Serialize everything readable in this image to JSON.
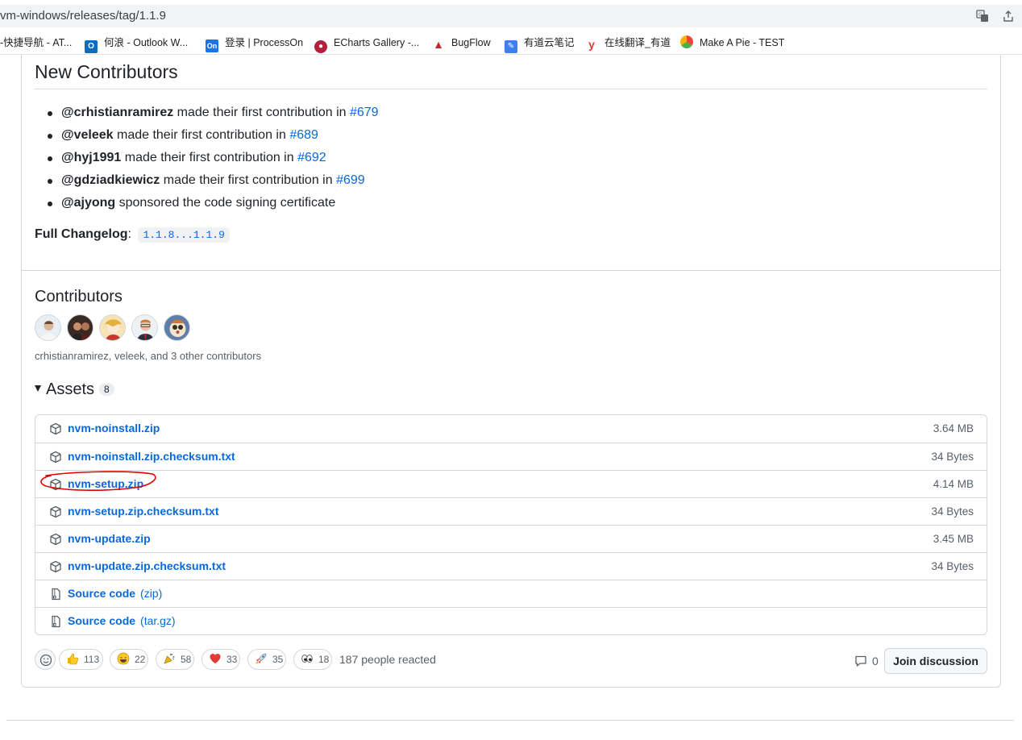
{
  "browser": {
    "url": "vm-windows/releases/tag/1.1.9",
    "translate_icon": "translate-icon",
    "share_icon": "share-icon",
    "bookmarks": [
      {
        "label": "-快捷导航 - AT...",
        "icon": "none"
      },
      {
        "label": "何浪 - Outlook W...",
        "icon": "outlook-icon",
        "color": "#0f6cbd"
      },
      {
        "label": "登录 | ProcessOn",
        "icon": "processon-icon",
        "color": "#1a73e8"
      },
      {
        "label": "ECharts Gallery -...",
        "icon": "echarts-icon",
        "color": "#b5213c"
      },
      {
        "label": "BugFlow",
        "icon": "bugflow-icon",
        "color": "#c62828"
      },
      {
        "label": "有道云笔记",
        "icon": "youdao-note-icon",
        "color": "#3f7ff1"
      },
      {
        "label": "在线翻译_有道",
        "icon": "youdao-icon",
        "color": "#e53935"
      },
      {
        "label": "Make A Pie - TEST",
        "icon": "makeapie-icon",
        "color": "#4caf50"
      }
    ]
  },
  "release": {
    "new_contributors_title": "New Contributors",
    "new_contributors": [
      {
        "user": "@crhistianramirez",
        "text": " made their first contribution in ",
        "pr": "#679"
      },
      {
        "user": "@veleek",
        "text": " made their first contribution in ",
        "pr": "#689"
      },
      {
        "user": "@hyj1991",
        "text": " made their first contribution in ",
        "pr": "#692"
      },
      {
        "user": "@gdziadkiewicz",
        "text": " made their first contribution in ",
        "pr": "#699"
      },
      {
        "user": "@ajyong",
        "text": " sponsored the code signing certificate",
        "pr": ""
      }
    ],
    "changelog_label": "Full Changelog",
    "changelog_colon": ":",
    "changelog_range": "1.1.8...1.1.9",
    "contributors_title": "Contributors",
    "contributors_summary": "crhistianramirez, veleek, and 3 other contributors",
    "avatars": [
      "avatar-crhistianramirez",
      "avatar-veleek",
      "avatar-hyj1991",
      "avatar-gdziadkiewicz",
      "avatar-ajyong"
    ],
    "assets_title": "Assets",
    "assets_count": "8",
    "assets": [
      {
        "name": "nvm-noinstall.zip",
        "ext": "",
        "size": "3.64 MB",
        "icon": "package-icon"
      },
      {
        "name": "nvm-noinstall.zip.checksum.txt",
        "ext": "",
        "size": "34 Bytes",
        "icon": "package-icon"
      },
      {
        "name": "nvm-setup.zip",
        "ext": "",
        "size": "4.14 MB",
        "icon": "package-icon"
      },
      {
        "name": "nvm-setup.zip.checksum.txt",
        "ext": "",
        "size": "34 Bytes",
        "icon": "package-icon"
      },
      {
        "name": "nvm-update.zip",
        "ext": "",
        "size": "3.45 MB",
        "icon": "package-icon"
      },
      {
        "name": "nvm-update.zip.checksum.txt",
        "ext": "",
        "size": "34 Bytes",
        "icon": "package-icon"
      },
      {
        "name": "Source code",
        "ext": "(zip)",
        "size": "",
        "icon": "file-zip-icon"
      },
      {
        "name": "Source code",
        "ext": "(tar.gz)",
        "size": "",
        "icon": "file-zip-icon"
      }
    ],
    "reactions": [
      {
        "emoji": "thumbs-up-icon",
        "count": "113"
      },
      {
        "emoji": "laugh-icon",
        "count": "22"
      },
      {
        "emoji": "hooray-icon",
        "count": "58"
      },
      {
        "emoji": "heart-icon",
        "count": "33"
      },
      {
        "emoji": "rocket-icon",
        "count": "35"
      },
      {
        "emoji": "eyes-icon",
        "count": "18"
      }
    ],
    "people_reacted": "187 people reacted",
    "comment_count": "0",
    "join_label": "Join discussion"
  },
  "colors": {
    "link": "#0969da",
    "border": "#d0d7de",
    "muted": "#57606a",
    "annotation": "#e00000"
  }
}
